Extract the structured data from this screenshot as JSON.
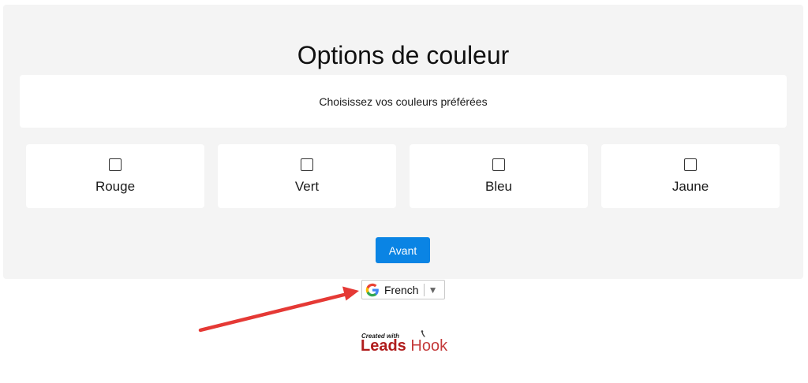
{
  "form": {
    "title": "Options de couleur",
    "subtitle": "Choisissez vos couleurs préférées",
    "options": [
      {
        "label": "Rouge",
        "checked": false
      },
      {
        "label": "Vert",
        "checked": false
      },
      {
        "label": "Bleu",
        "checked": false
      },
      {
        "label": "Jaune",
        "checked": false
      }
    ],
    "next_label": "Avant"
  },
  "translate_widget": {
    "icon": "google-g-icon",
    "selected_language": "French",
    "caret": "▼"
  },
  "footer": {
    "created_with": "Created with",
    "brand_bold": "Leads",
    "brand_light": "Hook"
  },
  "colors": {
    "panel_bg": "#f4f4f4",
    "button_bg": "#0a84e4",
    "arrow": "#e53935",
    "brand": "#b01c1c"
  }
}
